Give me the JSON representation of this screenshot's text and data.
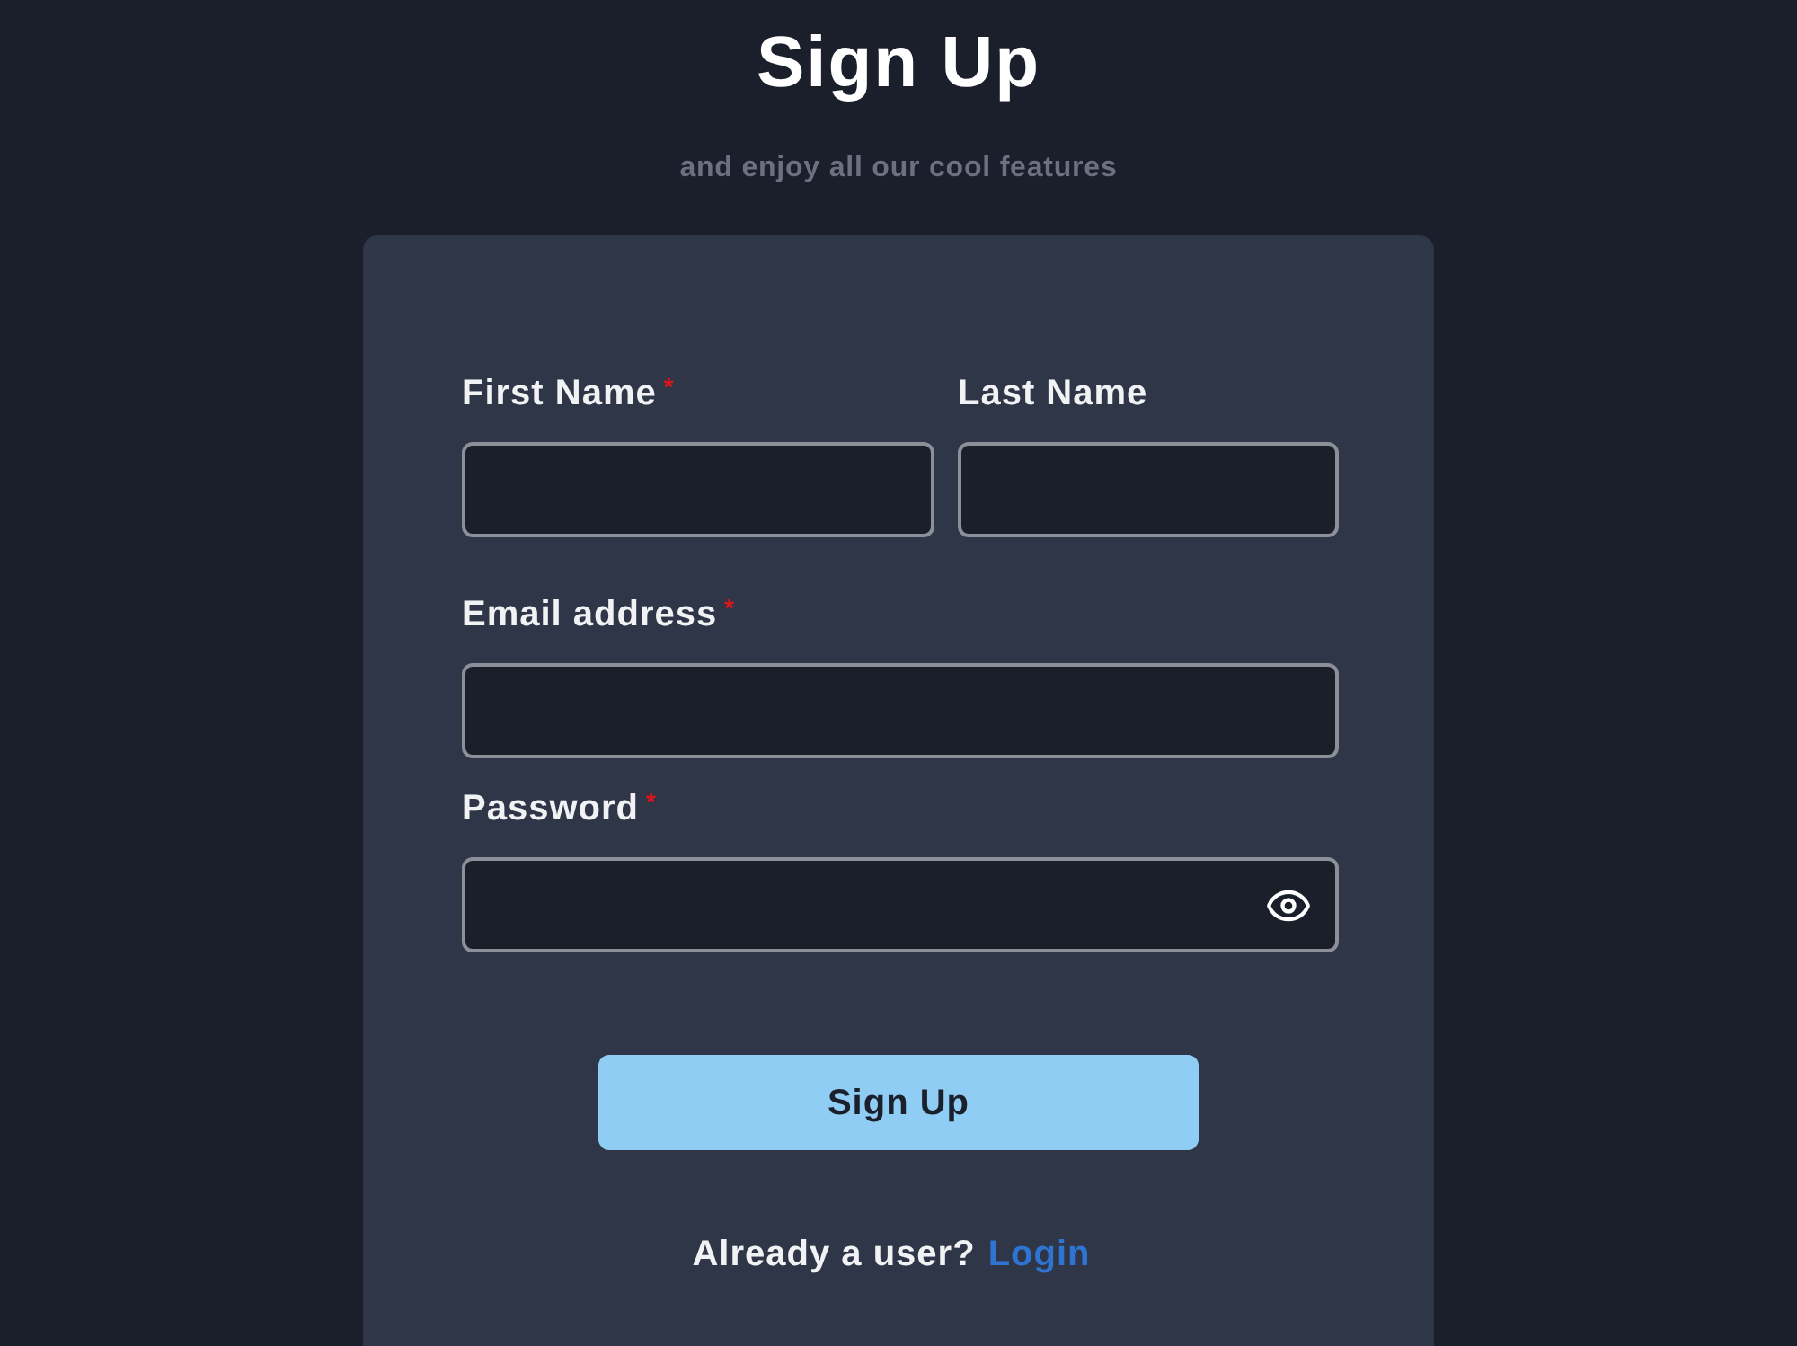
{
  "title": "Sign Up",
  "subtitle": "and enjoy all our cool features",
  "form": {
    "rows": [
      [
        {
          "label": "First Name",
          "required_mark": "*",
          "kind": "text"
        },
        {
          "label": "Last Name",
          "kind": "text"
        }
      ],
      [
        {
          "label": "Email address",
          "required_mark": "*",
          "kind": "text"
        }
      ],
      [
        {
          "label": "Password",
          "required_mark": "*",
          "kind": "password"
        }
      ]
    ],
    "submit": "Sign Up",
    "footer": {
      "text": "Already a user?",
      "link": "Login"
    }
  }
}
